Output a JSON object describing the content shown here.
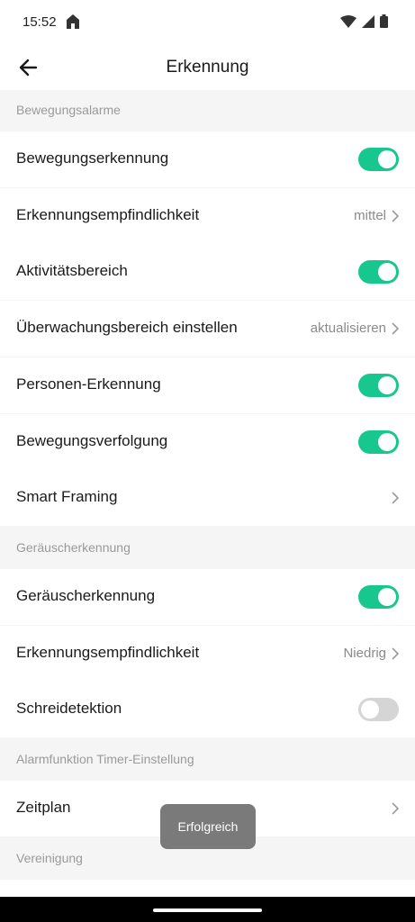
{
  "status_bar": {
    "time": "15:52"
  },
  "header": {
    "title": "Erkennung"
  },
  "sections": [
    {
      "title": "Bewegungsalarme",
      "rows": [
        {
          "label": "Bewegungserkennung",
          "toggle": "on"
        },
        {
          "label": "Erkennungsempfindlichkeit",
          "value": "mittel"
        },
        {
          "label": "Aktivitätsbereich",
          "toggle": "on"
        },
        {
          "label": "Überwachungsbereich einstellen",
          "value": "aktualisieren"
        },
        {
          "label": "Personen-Erkennung",
          "toggle": "on"
        },
        {
          "label": "Bewegungsverfolgung",
          "toggle": "on"
        },
        {
          "label": "Smart Framing"
        }
      ]
    },
    {
      "title": "Geräuscherkennung",
      "rows": [
        {
          "label": "Geräuscherkennung",
          "toggle": "on"
        },
        {
          "label": "Erkennungsempfindlichkeit",
          "value": "Niedrig"
        },
        {
          "label": "Schreidetektion",
          "toggle": "off"
        }
      ]
    },
    {
      "title": "Alarmfunktion Timer-Einstellung",
      "rows": [
        {
          "label": "Zeitplan"
        }
      ]
    },
    {
      "title": "Vereinigung",
      "rows": []
    }
  ],
  "toast": {
    "text": "Erfolgreich"
  },
  "colors": {
    "toggle_on": "#18c78e",
    "toggle_off": "#d5d5d5",
    "section_text": "#9a9a9a"
  },
  "icons": [
    "home-icon",
    "wifi-icon",
    "cellular-signal-icon",
    "battery-icon",
    "back-arrow-icon",
    "chevron-right-icon"
  ]
}
